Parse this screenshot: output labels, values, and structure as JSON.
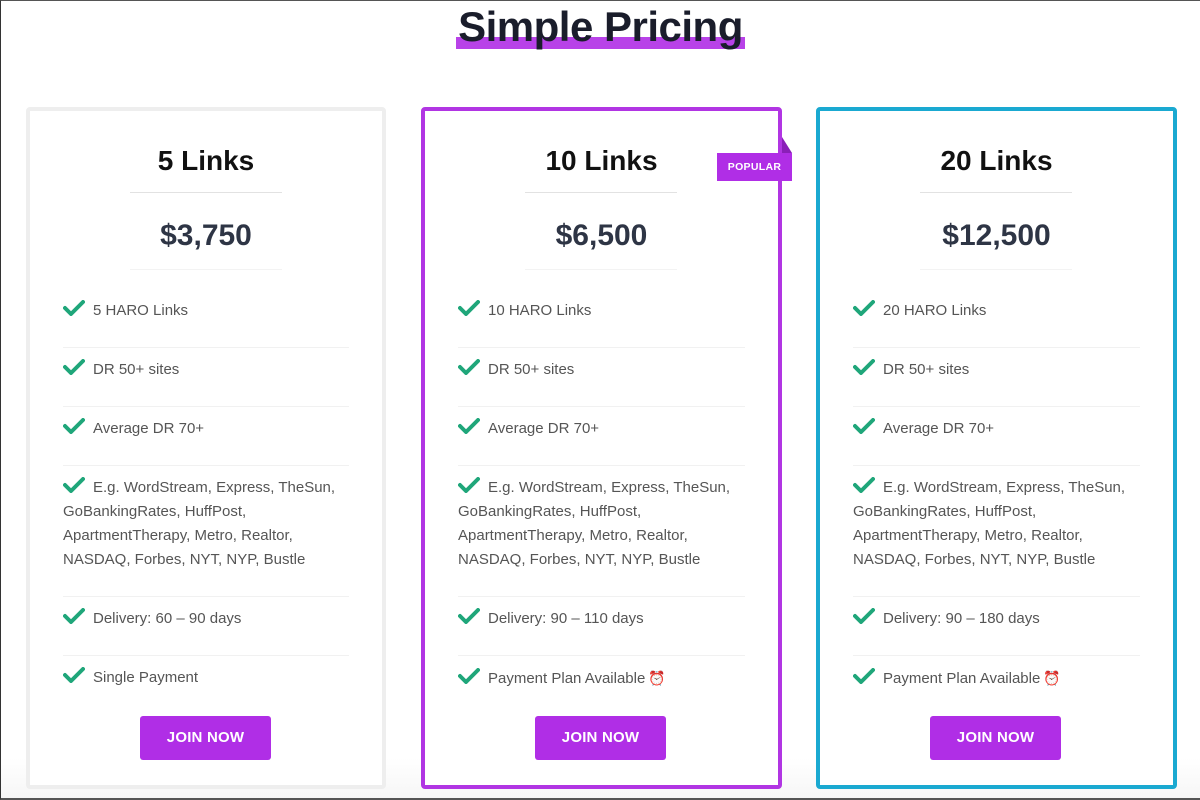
{
  "header": {
    "title": "Simple Pricing"
  },
  "colors": {
    "accent_purple": "#b02ee6",
    "highlight_purple": "#b842e8",
    "popular_border": "#b135e3",
    "premium_border": "#1aa9d1",
    "basic_border": "#eeeeee",
    "check_green": "#1fa67a"
  },
  "plans": [
    {
      "name": "5 Links",
      "price": "$3,750",
      "badge": null,
      "features": [
        {
          "text": "5 HARO Links",
          "icon": "check-icon"
        },
        {
          "text": "DR 50+ sites",
          "icon": "check-icon"
        },
        {
          "text": "Average DR 70+",
          "icon": "check-icon"
        },
        {
          "text": "E.g. WordStream, Express, TheSun, GoBankingRates, HuffPost, ApartmentTherapy, Metro, Realtor, NASDAQ, Forbes, NYT, NYP, Bustle",
          "icon": "check-icon"
        },
        {
          "text": "Delivery: 60 – 90 days",
          "icon": "check-icon"
        },
        {
          "text": "Single Payment",
          "icon": "check-icon"
        }
      ],
      "cta": "JOIN NOW"
    },
    {
      "name": "10 Links",
      "price": "$6,500",
      "badge": "POPULAR",
      "features": [
        {
          "text": "10 HARO Links",
          "icon": "check-icon"
        },
        {
          "text": "DR 50+ sites",
          "icon": "check-icon"
        },
        {
          "text": "Average DR 70+",
          "icon": "check-icon"
        },
        {
          "text": "E.g. WordStream, Express, TheSun, GoBankingRates, HuffPost, ApartmentTherapy, Metro, Realtor, NASDAQ, Forbes, NYT, NYP, Bustle",
          "icon": "check-icon"
        },
        {
          "text": "Delivery: 90 – 110 days",
          "icon": "check-icon"
        },
        {
          "text": "Payment Plan Available",
          "icon": "check-icon",
          "suffix_icon": "alarm-clock-icon",
          "suffix_glyph": "⏰"
        }
      ],
      "cta": "JOIN NOW"
    },
    {
      "name": "20 Links",
      "price": "$12,500",
      "badge": null,
      "features": [
        {
          "text": "20 HARO Links",
          "icon": "check-icon"
        },
        {
          "text": "DR 50+ sites",
          "icon": "check-icon"
        },
        {
          "text": "Average DR 70+",
          "icon": "check-icon"
        },
        {
          "text": "E.g. WordStream, Express, TheSun, GoBankingRates, HuffPost, ApartmentTherapy, Metro, Realtor, NASDAQ, Forbes, NYT, NYP, Bustle",
          "icon": "check-icon"
        },
        {
          "text": "Delivery: 90 – 180 days",
          "icon": "check-icon"
        },
        {
          "text": "Payment Plan Available",
          "icon": "check-icon",
          "suffix_icon": "alarm-clock-icon",
          "suffix_glyph": "⏰"
        }
      ],
      "cta": "JOIN NOW"
    }
  ]
}
